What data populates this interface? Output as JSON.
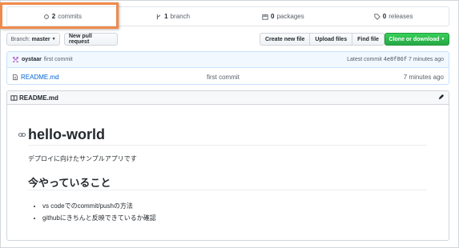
{
  "stats": {
    "commits_count": "2",
    "commits_label": "commits",
    "branch_count": "1",
    "branch_label": "branch",
    "packages_count": "0",
    "packages_label": "packages",
    "releases_count": "0",
    "releases_label": "releases"
  },
  "toolbar": {
    "branch_prefix": "Branch:",
    "branch_value": "master",
    "new_pr": "New pull request",
    "create_file": "Create new file",
    "upload_files": "Upload files",
    "find_file": "Find file",
    "clone": "Clone or download"
  },
  "commit": {
    "author": "oystaar",
    "message": "first commit",
    "latest_label": "Latest commit",
    "sha": "4e8f86f",
    "age": "7 minutes ago"
  },
  "files": [
    {
      "name": "README.md",
      "message": "first commit",
      "age": "7 minutes ago"
    }
  ],
  "readme": {
    "title": "README.md",
    "h1": "hello-world",
    "paragraph": "デプロイに向けたサンプルアプリです",
    "h2": "今やっていること",
    "items": [
      "vs codeでのcommit/pushの方法",
      "githubにきちんと反映できているか確認"
    ]
  },
  "colors": {
    "highlight": "#f08a4b",
    "green": "#28a745",
    "link": "#0366d6"
  }
}
